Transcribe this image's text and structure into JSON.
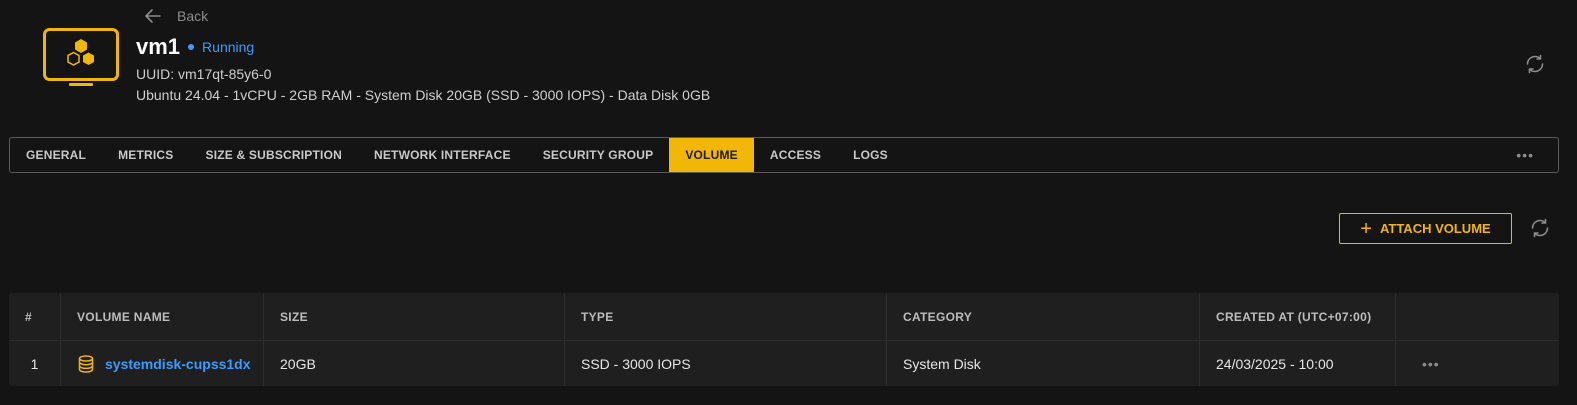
{
  "header": {
    "back_label": "Back",
    "vm_name": "vm1",
    "status": "Running",
    "uuid": "UUID: vm17qt-85y6-0",
    "spec": "Ubuntu 24.04 - 1vCPU - 2GB RAM - System Disk 20GB (SSD - 3000 IOPS) - Data Disk 0GB",
    "icons": {
      "back": "arrow-left-icon",
      "vm": "vm-monitor-icon",
      "refresh": "refresh-icon"
    }
  },
  "tabs": [
    {
      "label": "GENERAL",
      "active": false
    },
    {
      "label": "METRICS",
      "active": false
    },
    {
      "label": "SIZE & SUBSCRIPTION",
      "active": false
    },
    {
      "label": "NETWORK INTERFACE",
      "active": false
    },
    {
      "label": "SECURITY GROUP",
      "active": false
    },
    {
      "label": "VOLUME",
      "active": true
    },
    {
      "label": "ACCESS",
      "active": false
    },
    {
      "label": "LOGS",
      "active": false
    }
  ],
  "tabs_more_label": "•••",
  "toolbar": {
    "attach_label": "ATTACH VOLUME",
    "attach_icon": "plus-icon",
    "refresh_icon": "refresh-icon"
  },
  "table": {
    "columns": [
      "#",
      "VOLUME NAME",
      "SIZE",
      "TYPE",
      "CATEGORY",
      "CREATED AT (UTC+07:00)",
      ""
    ],
    "rows": [
      {
        "index": "1",
        "name": "systemdisk-cupss1dx",
        "size": "20GB",
        "type": "SSD - 3000 IOPS",
        "category": "System Disk",
        "created_at": "24/03/2025 - 10:00",
        "actions": "•••"
      }
    ]
  },
  "colors": {
    "background": "#141414",
    "accent": "#f2b705",
    "link": "#3b9cff",
    "table_bg": "#1f1f1f"
  }
}
